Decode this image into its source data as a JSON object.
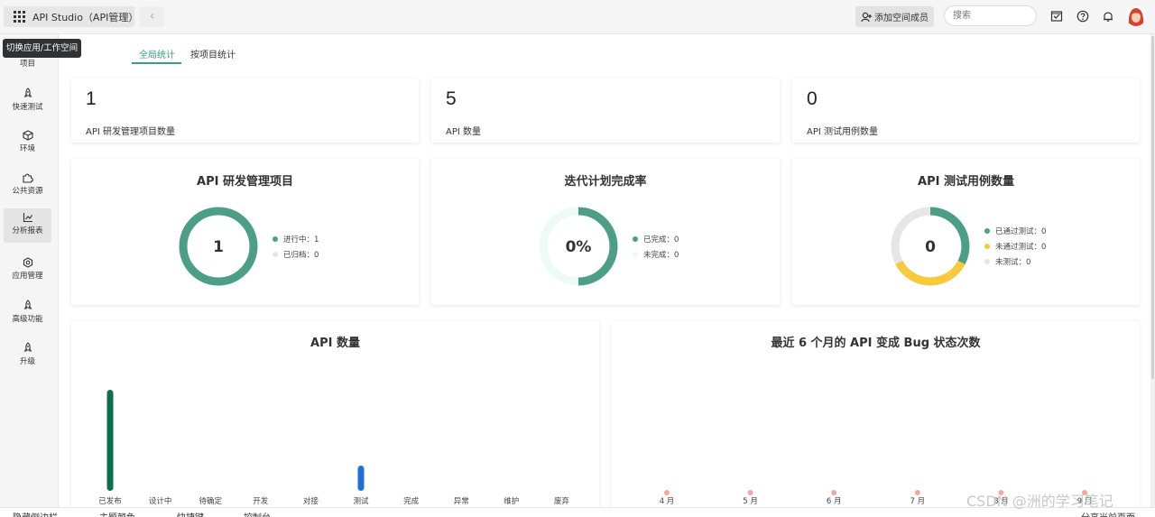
{
  "topbar": {
    "app_name": "API Studio（API管理）",
    "invite_label": "添加空间成员",
    "search_placeholder": "搜索"
  },
  "tooltip": "切换应用/工作空间",
  "sidebar": {
    "items": [
      {
        "label": "项目",
        "icon": "project-icon"
      },
      {
        "label": "快速测试",
        "icon": "rocket-icon"
      },
      {
        "label": "环境",
        "icon": "cube-icon"
      },
      {
        "label": "公共资源",
        "icon": "puzzle-icon"
      },
      {
        "label": "分析报表",
        "icon": "chart-icon"
      },
      {
        "label": "应用管理",
        "icon": "gear-icon"
      },
      {
        "label": "高级功能",
        "icon": "rocket-icon"
      },
      {
        "label": "升级",
        "icon": "rocket-icon"
      }
    ]
  },
  "tabs": [
    "全局统计",
    "按项目统计"
  ],
  "stats": [
    {
      "value": "1",
      "label": "API 研发管理项目数量"
    },
    {
      "value": "5",
      "label": "API 数量"
    },
    {
      "value": "0",
      "label": "API 测试用例数量"
    }
  ],
  "donuts": [
    {
      "title": "API 研发管理项目",
      "center": "1",
      "legend": [
        "进行中：1",
        "已归档：0"
      ]
    },
    {
      "title": "迭代计划完成率",
      "center": "0%",
      "legend": [
        "已完成：0",
        "未完成：0"
      ]
    },
    {
      "title": "API 测试用例数量",
      "center": "0",
      "legend": [
        "已通过测试：0",
        "未通过测试：0",
        "未测试：0"
      ]
    }
  ],
  "chart_data": [
    {
      "type": "bar",
      "title": "API 数量",
      "categories": [
        "已发布",
        "设计中",
        "待确定",
        "开发",
        "对接",
        "测试",
        "完成",
        "异常",
        "维护",
        "废弃"
      ],
      "values": [
        4,
        0,
        0,
        0,
        0,
        1,
        0,
        0,
        0,
        0
      ],
      "colors": [
        "#0e6e52",
        null,
        null,
        null,
        null,
        null,
        "#1f6fd6",
        null,
        null,
        null
      ]
    },
    {
      "type": "line",
      "title": "最近 6 个月的 API 变成 Bug 状态次数",
      "categories": [
        "4 月",
        "5 月",
        "6 月",
        "7 月",
        "8 月",
        "9 月"
      ],
      "values": [
        0,
        0,
        0,
        0,
        0,
        0
      ]
    }
  ],
  "bottombar": [
    "隐藏侧边栏",
    "主题颜色",
    "快捷键",
    "控制台",
    "分享当前页面"
  ],
  "watermark": "CSDN @洲的学习笔记",
  "colors": {
    "accent": "#3b9e80",
    "donut_green": "#4c9e86",
    "donut_gray": "#e6e6e6",
    "yellow": "#f7c93b",
    "blue": "#1f6fd6",
    "pink": "#f2a7a7"
  }
}
